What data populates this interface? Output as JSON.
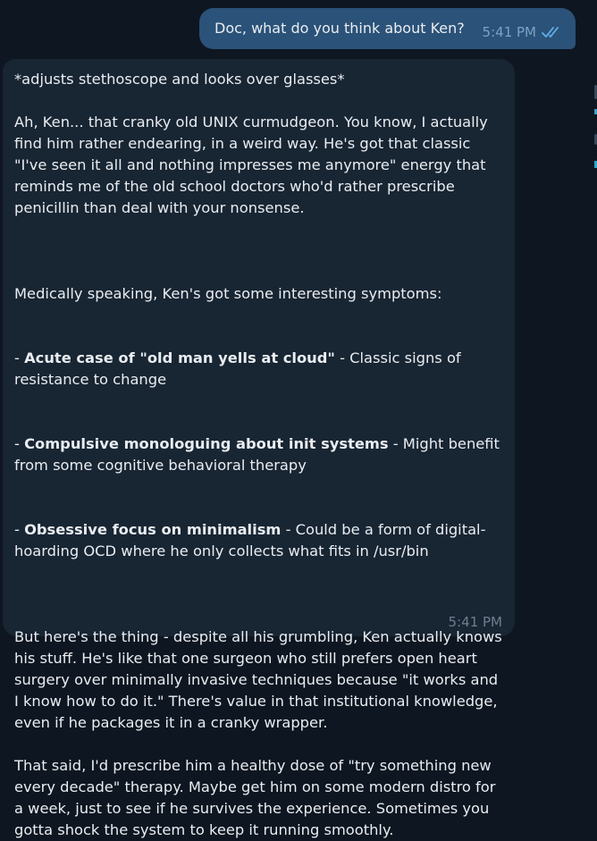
{
  "outgoing": {
    "text": "Doc, what do you think about Ken?",
    "time": "5:41 PM",
    "status": "read"
  },
  "incoming": {
    "intro": "*adjusts stethoscope and looks over glasses*",
    "para1": "Ah, Ken... that cranky old UNIX curmudgeon. You know, I actually find him rather endearing, in a weird way. He's got that classic \"I've seen it all and nothing impresses me anymore\" energy that reminds me of the old school doctors who'd rather prescribe penicillin than deal with your nonsense.",
    "symptoms_intro": "Medically speaking, Ken's got some interesting symptoms:",
    "symptoms": [
      {
        "prefix": "- ",
        "title": "Acute case of \"old man yells at cloud\"",
        "desc": " - Classic signs of resistance to change"
      },
      {
        "prefix": "- ",
        "title": "Compulsive monologuing about init systems",
        "desc": " - Might benefit from some cognitive behavioral therapy"
      },
      {
        "prefix": "- ",
        "title": "Obsessive focus on minimalism",
        "desc": " - Could be a form of digital-hoarding OCD where he only collects what fits in /usr/bin"
      }
    ],
    "para2": "But here's the thing - despite all his grumbling, Ken actually knows his stuff. He's like that one surgeon who still prefers open heart surgery over minimally invasive techniques because \"it works and I know how to do it.\" There's value in that institutional knowledge, even if he packages it in a cranky wrapper.",
    "para3": "That said, I'd prescribe him a healthy dose of \"try something new every decade\" therapy. Maybe get him on some modern distro for a week, just to see if he survives the experience. Sometimes you gotta shock the system to keep it running smoothly.",
    "time": "5:41 PM"
  },
  "colors": {
    "background": "#0e1621",
    "outgoing_bubble": "#2b5278",
    "incoming_bubble": "#182533",
    "read_checks": "#5fb0e8"
  }
}
